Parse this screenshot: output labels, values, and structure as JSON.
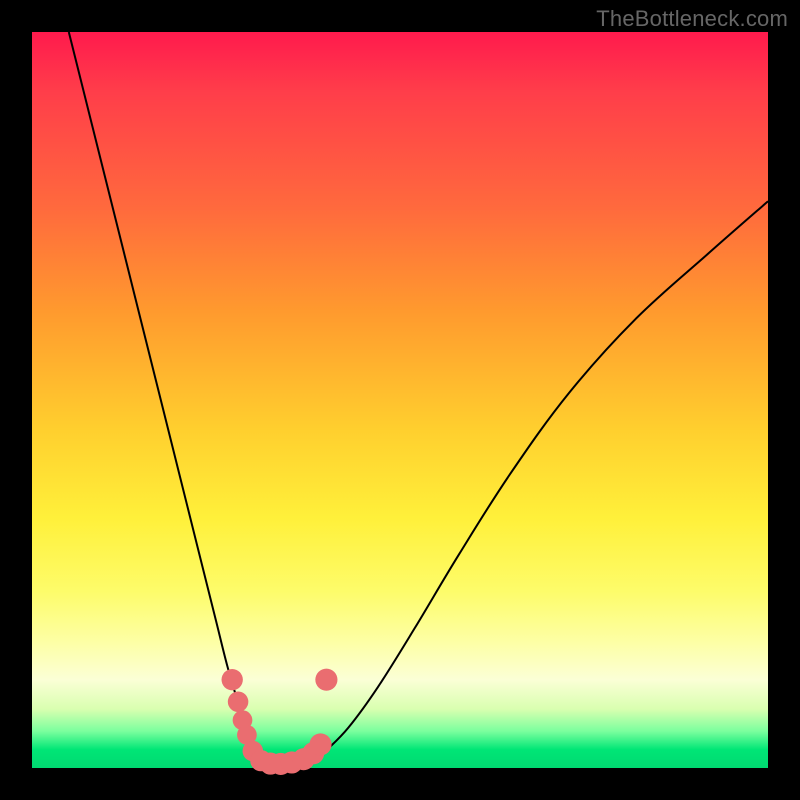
{
  "watermark": "TheBottleneck.com",
  "palette": {
    "marker_fill": "#ea6d70",
    "marker_stroke": "#c94f55",
    "curve_stroke": "#000000"
  },
  "chart_data": {
    "type": "line",
    "title": "",
    "xlabel": "",
    "ylabel": "",
    "xlim": [
      0,
      100
    ],
    "ylim": [
      0,
      100
    ],
    "grid": false,
    "legend": false,
    "series": [
      {
        "name": "left-branch",
        "x": [
          5,
          8,
          11,
          14,
          17,
          20,
          22.5,
          25,
          26.5,
          27.8,
          28.8,
          29.5,
          30.1,
          30.6
        ],
        "y": [
          100,
          88,
          76,
          64,
          52,
          40,
          30,
          20,
          14,
          9.5,
          6,
          3.5,
          1.8,
          0.9
        ]
      },
      {
        "name": "valley",
        "x": [
          30.6,
          31.2,
          32.0,
          33.0,
          34.2,
          35.5,
          37.0,
          38.5,
          40.0
        ],
        "y": [
          0.9,
          0.5,
          0.3,
          0.25,
          0.3,
          0.45,
          0.8,
          1.4,
          2.4
        ]
      },
      {
        "name": "right-branch",
        "x": [
          40.0,
          43,
          47,
          52,
          58,
          65,
          73,
          82,
          92,
          100
        ],
        "y": [
          2.4,
          5.5,
          11,
          19,
          29,
          40,
          51,
          61,
          70,
          77
        ]
      }
    ],
    "markers": {
      "name": "points-near-minimum",
      "x": [
        27.2,
        28.0,
        28.6,
        29.2,
        30.0,
        31.1,
        32.4,
        33.8,
        35.3,
        36.9,
        38.2,
        39.2,
        40.0
      ],
      "y": [
        12.0,
        9.0,
        6.5,
        4.5,
        2.3,
        1.0,
        0.6,
        0.55,
        0.75,
        1.2,
        2.0,
        3.2,
        12.0
      ],
      "r": [
        1.4,
        1.3,
        1.2,
        1.2,
        1.3,
        1.4,
        1.5,
        1.5,
        1.5,
        1.5,
        1.5,
        1.5,
        1.5
      ]
    }
  }
}
